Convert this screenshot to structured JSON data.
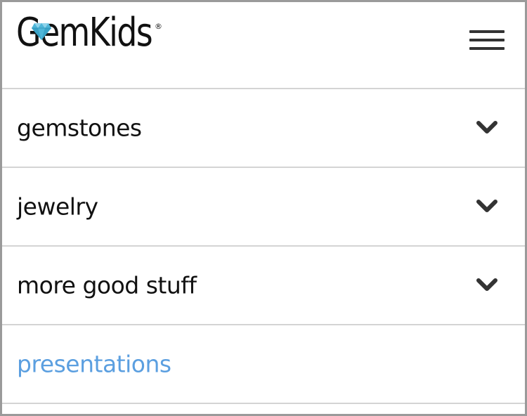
{
  "brand": {
    "name": "GemKids",
    "registered_mark": "®",
    "gem_color": "#4fb6d8"
  },
  "header": {
    "menu_icon": "hamburger-icon"
  },
  "menu": {
    "items": [
      {
        "label": "gemstones",
        "expandable": true,
        "icon": "chevron-down-icon"
      },
      {
        "label": "jewelry",
        "expandable": true,
        "icon": "chevron-down-icon"
      },
      {
        "label": "more good stuff",
        "expandable": true,
        "icon": "chevron-down-icon"
      },
      {
        "label": "presentations",
        "expandable": false,
        "link_color": "#5b9fe0"
      }
    ]
  }
}
